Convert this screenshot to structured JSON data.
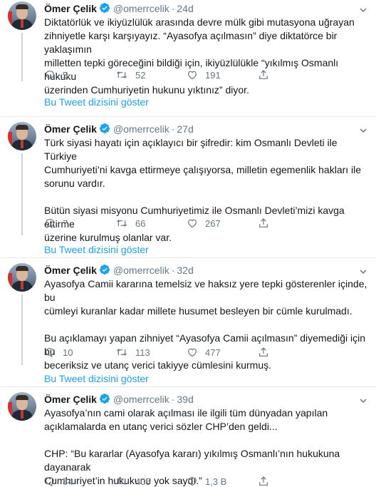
{
  "author": {
    "name": "Ömer Çelik",
    "handle": "@omerrcelik",
    "separator": "·"
  },
  "thread_link_label": "Bu Tweet dizisini göster",
  "tweets": [
    {
      "time": "24d",
      "text": "Diktatörlük ve ikiyüzlülük arasında devre mülk gibi mutasyona uğrayan\nzihniyetle karşı karşıyayız. “Ayasofya açılmasın” diye diktatörce bir yaklaşımın\nmilletten tepki göreceğini bildiği için, ikiyüzlülükle “yıkılmış Osmanlı hukuku\nüzerinden Cumhuriyetin hukunu yıktınız” diyor.",
      "replies": "5",
      "retweets": "52",
      "likes": "191"
    },
    {
      "time": "27d",
      "text": "Türk siyasi hayatı için açıklayıcı bir şifredir: kim Osmanlı Devleti ile Türkiye\nCumhuriyeti’ni kavga ettirmeye çalışıyorsa, milletin egemenlik hakları ile\nsorunu vardır.\n\nBütün siyasi misyonu Cumhuriyetimiz ile Osmanlı Devleti’mizi kavga ettirme\nüzerine kurulmuş olanlar var.",
      "replies": "7",
      "retweets": "66",
      "likes": "267"
    },
    {
      "time": "32d",
      "text": "Ayasofya Camii kararına temelsiz ve haksız yere tepki gösterenler içinde, bu\ncümleyi kuranlar kadar millete husumet besleyen bir cümle kurulmadı.\n\nBu açıklamayı yapan zihniyet “Ayasofya Camii açılmasın” diyemediği için bu\nbeceriksiz ve utanç verici takiyye cümlesini kurmuş.",
      "replies": "10",
      "retweets": "113",
      "likes": "477"
    },
    {
      "time": "39d",
      "text": "Ayasofya’nın cami olarak açılması ile ilgili tüm dünyadan yapılan\naçıklamalarda en utanç verici sözler CHP’den geldi...\n\nCHP: “Bu kararlar (Ayasofya kararı) yıkılmış Osmanlı’nın hukukuna dayanarak\nCumhuriyet’in hukukunu yok saydı.”",
      "replies": "84",
      "retweets": "405",
      "likes": "1,3 B"
    }
  ],
  "colors": {
    "link": "#1da1f2",
    "muted": "#657786",
    "verified": "#1da1f2",
    "border": "#e6ecf0"
  },
  "icons": [
    "verified-badge-icon",
    "chevron-down-icon",
    "reply-icon",
    "retweet-icon",
    "like-icon",
    "share-icon"
  ]
}
